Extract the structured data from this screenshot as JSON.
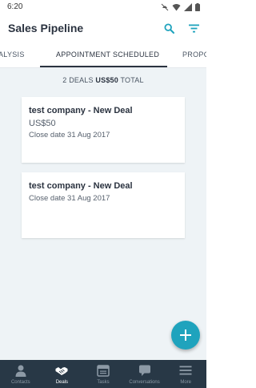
{
  "status_bar": {
    "time": "6:20"
  },
  "header": {
    "title": "Sales Pipeline"
  },
  "tabs": [
    {
      "label": "ALYSIS",
      "active": false
    },
    {
      "label": "APPOINTMENT SCHEDULED",
      "active": true
    },
    {
      "label": "PROPO",
      "active": false
    }
  ],
  "summary": {
    "count_label": "2 DEALS",
    "amount": "US$50",
    "total_label": "TOTAL"
  },
  "deals": [
    {
      "name": "test company - New Deal",
      "amount": "US$50",
      "close_date": "Close date 31 Aug 2017"
    },
    {
      "name": "test company - New Deal",
      "amount": "",
      "close_date": "Close date 31 Aug 2017"
    }
  ],
  "fab": {
    "icon": "plus-icon"
  },
  "bottom_nav": [
    {
      "label": "Contacts",
      "icon": "person-icon",
      "active": false
    },
    {
      "label": "Deals",
      "icon": "handshake-icon",
      "active": true
    },
    {
      "label": "Tasks",
      "icon": "calendar-icon",
      "active": false
    },
    {
      "label": "Conversations",
      "icon": "chat-icon",
      "active": false
    },
    {
      "label": "More",
      "icon": "menu-icon",
      "active": false
    }
  ],
  "colors": {
    "accent": "#1fa3bd",
    "nav_background": "#283846",
    "content_background": "#eef3f6",
    "text_primary": "#2b3340"
  }
}
